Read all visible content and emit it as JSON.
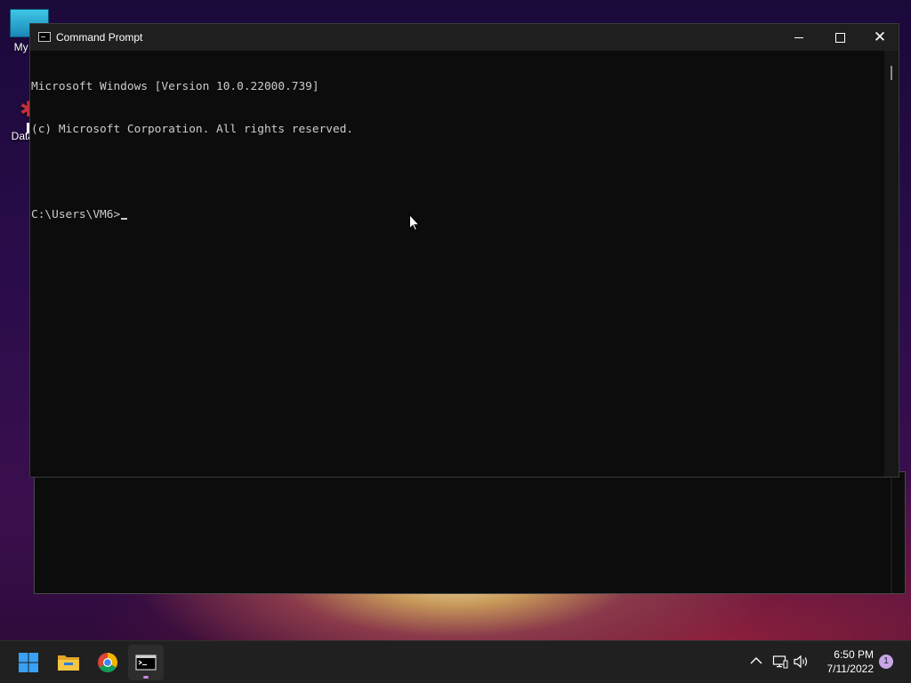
{
  "desktop": {
    "icons": [
      {
        "label": "My Co",
        "icon": "computer-icon"
      },
      {
        "label": "DataW",
        "icon": "datawizard-icon"
      }
    ]
  },
  "window": {
    "title": "Command Prompt",
    "icon": "cmd-icon",
    "controls": {
      "minimize": "minimize-icon",
      "maximize": "maximize-icon",
      "close": "close-icon",
      "close_glyph": "✕"
    }
  },
  "console": {
    "lines": [
      "Microsoft Windows [Version 10.0.22000.739]",
      "(c) Microsoft Corporation. All rights reserved.",
      "",
      "C:\\Users\\VM6>"
    ]
  },
  "taskbar": {
    "apps": [
      {
        "name": "Start",
        "icon": "windows-start-icon"
      },
      {
        "name": "File Explorer",
        "icon": "folder-icon"
      },
      {
        "name": "Google Chrome",
        "icon": "chrome-icon"
      },
      {
        "name": "Command Prompt",
        "icon": "cmd-icon",
        "active": true
      }
    ],
    "tray": {
      "chevron": "^",
      "time": "6:50 PM",
      "date": "7/11/2022",
      "notification_count": "1"
    }
  },
  "colors": {
    "console_bg": "#0c0c0c",
    "console_fg": "#cccccc",
    "titlebar_bg": "#1f1f1f",
    "taskbar_bg": "#202020",
    "accent": "#c8a5e6"
  }
}
